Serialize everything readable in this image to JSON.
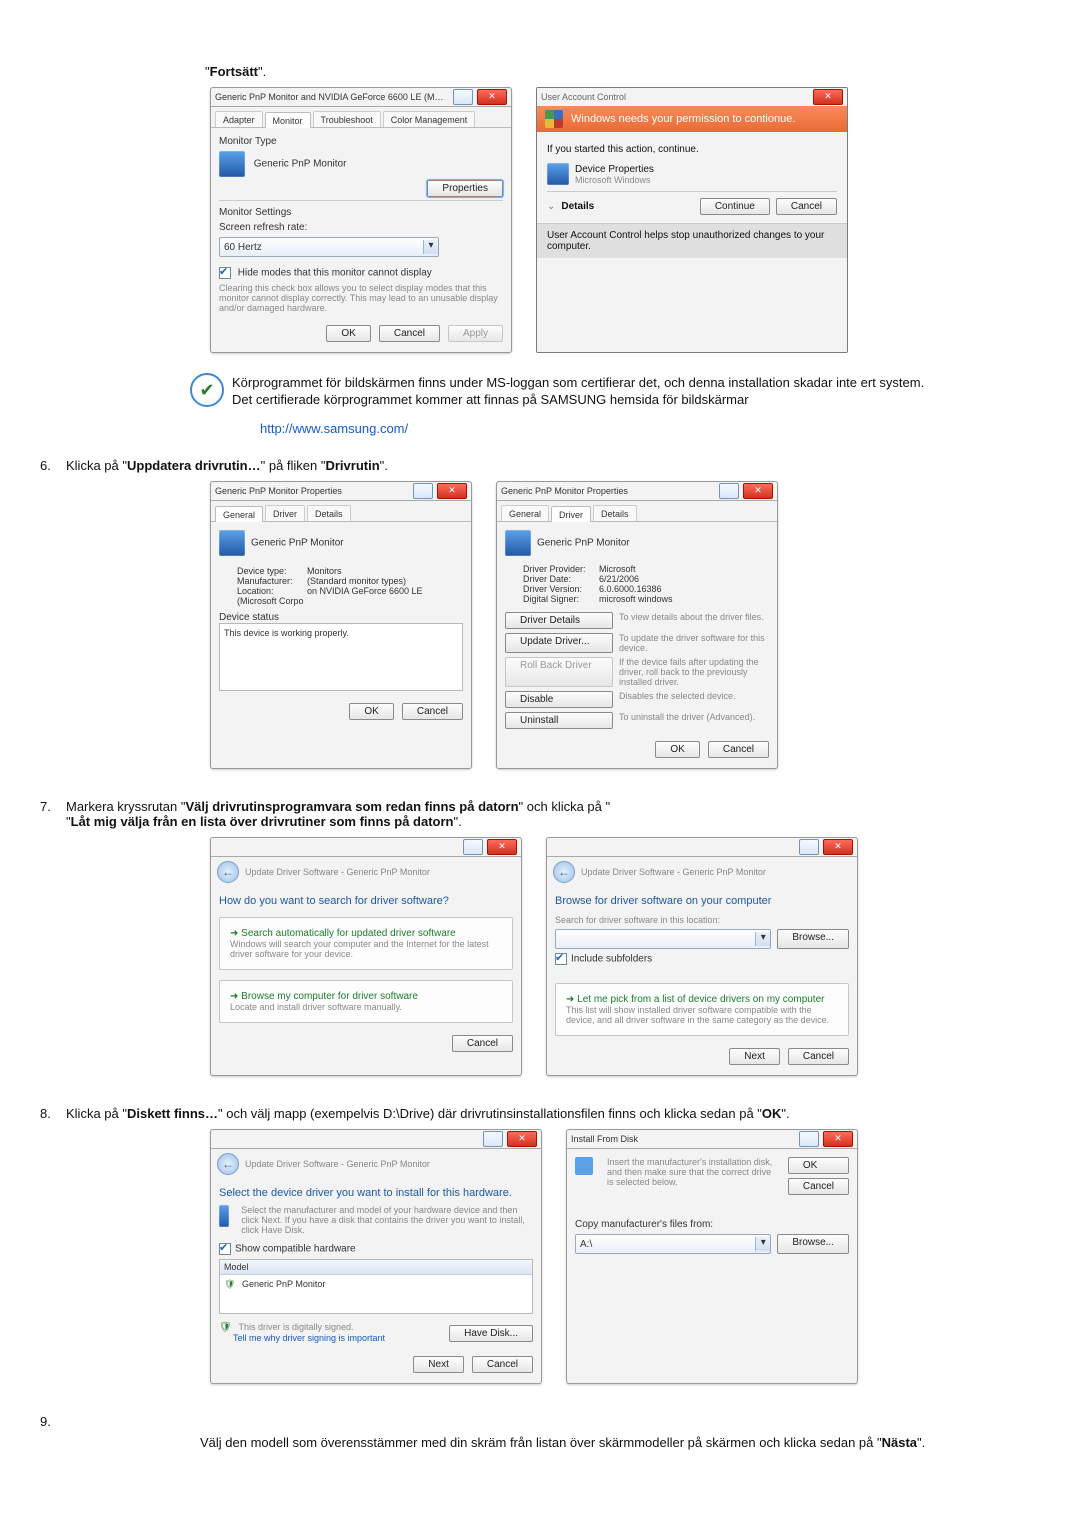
{
  "intro_word": "Fortsätt",
  "intro_suffix": "\".",
  "dlg1": {
    "title": "Generic PnP Monitor and NVIDIA GeForce 6600 LE (Microsoft Co...",
    "tabs": [
      "Adapter",
      "Monitor",
      "Troubleshoot",
      "Color Management"
    ],
    "sec1": "Monitor Type",
    "monname": "Generic PnP Monitor",
    "props_btn": "Properties",
    "sec2": "Monitor Settings",
    "refresh_lbl": "Screen refresh rate:",
    "refresh_val": "60 Hertz",
    "chk_lbl": "Hide modes that this monitor cannot display",
    "warn": "Clearing this check box allows you to select display modes that this monitor cannot display correctly. This may lead to an unusable display and/or damaged hardware.",
    "ok": "OK",
    "cancel": "Cancel",
    "apply": "Apply"
  },
  "uac": {
    "bar": "User Account Control",
    "headline": "Windows needs your permission to contionue.",
    "started": "If you started this action, continue.",
    "prop": "Device Properties",
    "vendor": "Microsoft Windows",
    "details": "Details",
    "cont": "Continue",
    "cancel": "Cancel",
    "foot": "User Account Control helps stop unauthorized changes to your computer."
  },
  "cert": {
    "l1": "Körprogrammet för bildskärmen finns under MS-loggan som certifierar det, och denna installation skadar inte ert system.",
    "l2": "Det certifierade körprogrammet kommer att finnas på SAMSUNG hemsida för bildskärmar",
    "link": "http://www.samsung.com/"
  },
  "step6": {
    "num": "6.",
    "a": "Klicka på \"",
    "b": "Uppdatera drivrutin…",
    "c": "\" på fliken \"",
    "d": "Drivrutin",
    "e": "\"."
  },
  "props1": {
    "title": "Generic PnP Monitor Properties",
    "tabs": [
      "General",
      "Driver",
      "Details"
    ],
    "monname": "Generic PnP Monitor",
    "r1k": "Device type:",
    "r1v": "Monitors",
    "r2k": "Manufacturer:",
    "r2v": "(Standard monitor types)",
    "r3k": "Location:",
    "r3v": "on NVIDIA GeForce 6600 LE (Microsoft Corpo",
    "statlbl": "Device status",
    "stattxt": "This device is working properly.",
    "ok": "OK",
    "cancel": "Cancel"
  },
  "props2": {
    "title": "Generic PnP Monitor Properties",
    "tabs": [
      "General",
      "Driver",
      "Details"
    ],
    "monname": "Generic PnP Monitor",
    "r1k": "Driver Provider:",
    "r1v": "Microsoft",
    "r2k": "Driver Date:",
    "r2v": "6/21/2006",
    "r3k": "Driver Version:",
    "r3v": "6.0.6000.16386",
    "r4k": "Digital Signer:",
    "r4v": "microsoft windows",
    "b1": "Driver Details",
    "b1t": "To view details about the driver files.",
    "b2": "Update Driver...",
    "b2t": "To update the driver software for this device.",
    "b3": "Roll Back Driver",
    "b3t": "If the device fails after updating the driver, roll back to the previously installed driver.",
    "b4": "Disable",
    "b4t": "Disables the selected device.",
    "b5": "Uninstall",
    "b5t": "To uninstall the driver (Advanced).",
    "ok": "OK",
    "cancel": "Cancel"
  },
  "step7": {
    "num": "7.",
    "a": "Markera kryssrutan \"",
    "b": "Välj drivrutinsprogramvara som redan finns på datorn",
    "c": "\" och klicka på \"",
    "d": "Låt mig välja från en lista över drivrutiner som finns på datorn",
    "e": "\"."
  },
  "wiz1": {
    "crumb": "Update Driver Software - Generic PnP Monitor",
    "q": "How do you want to search for driver software?",
    "o1": "Search automatically for updated driver software",
    "o1s": "Windows will search your computer and the Internet for the latest driver software for your device.",
    "o2": "Browse my computer for driver software",
    "o2s": "Locate and install driver software manually.",
    "cancel": "Cancel"
  },
  "wiz2": {
    "crumb": "Update Driver Software - Generic PnP Monitor",
    "q": "Browse for driver software on your computer",
    "lbl": "Search for driver software in this location:",
    "browse": "Browse...",
    "chk": "Include subfolders",
    "o1": "Let me pick from a list of device drivers on my computer",
    "o1s": "This list will show installed driver software compatible with the device, and all driver software in the same category as the device.",
    "next": "Next",
    "cancel": "Cancel"
  },
  "step8": {
    "num": "8.",
    "a": "Klicka på \"",
    "b": "Diskett finns…",
    "c": "\" och välj mapp (exempelvis D:\\Drive) där drivrutinsinstallationsfilen finns och klicka sedan på \"",
    "d": "OK",
    "e": "\"."
  },
  "wiz3": {
    "crumb": "Update Driver Software - Generic PnP Monitor",
    "q": "Select the device driver you want to install for this hardware.",
    "sub": "Select the manufacturer and model of your hardware device and then click Next. If you have a disk that contains the driver you want to install, click Have Disk.",
    "show": "Show compatible hardware",
    "model": "Model",
    "item": "Generic PnP Monitor",
    "signed": "This driver is digitally signed.",
    "why": "Tell me why driver signing is important",
    "have": "Have Disk...",
    "next": "Next",
    "cancel": "Cancel"
  },
  "ifd": {
    "title": "Install From Disk",
    "msg": "Insert the manufacturer's installation disk, and then make sure that the correct drive is selected below.",
    "ok": "OK",
    "cancel": "Cancel",
    "copy": "Copy manufacturer's files from:",
    "path": "A:\\",
    "browse": "Browse..."
  },
  "step9": {
    "num": "9.",
    "text": "Välj den modell som överensstämmer med din skräm från listan över skärmmodeller på skärmen och klicka sedan på \"",
    "b": "Nästa",
    "e": "\"."
  }
}
